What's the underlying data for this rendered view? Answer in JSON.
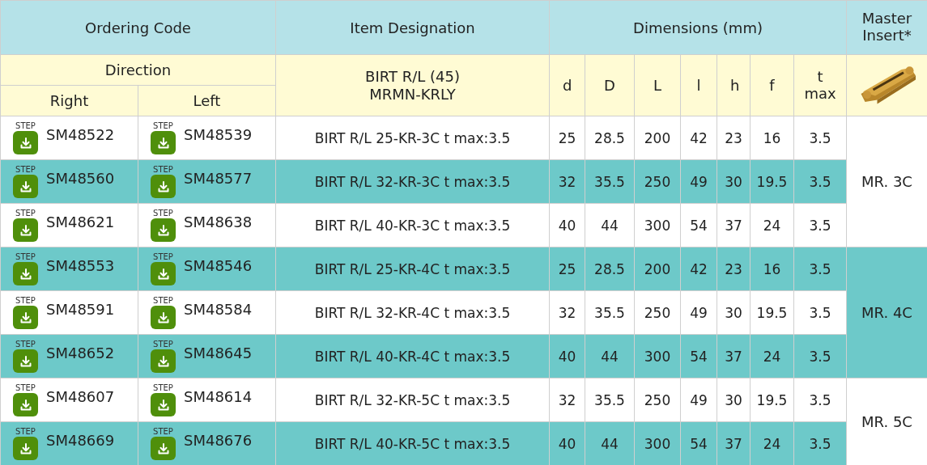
{
  "header": {
    "ordering_code": "Ordering Code",
    "item_designation": "Item Designation",
    "dimensions": "Dimensions (mm)",
    "master_insert": "Master Insert*",
    "direction": "Direction",
    "right": "Right",
    "left": "Left",
    "designation_family": "BIRT R/L (45)",
    "designation_insert": "MRMN-KRLY",
    "dimension_columns": [
      "d",
      "D",
      "L",
      "l",
      "h",
      "f",
      "t max"
    ]
  },
  "groups": [
    {
      "master": "MR. 3C",
      "rows": [
        {
          "right": {
            "badge": "STEP",
            "code": "SM48522"
          },
          "left": {
            "badge": "STEP",
            "code": "SM48539"
          },
          "designation": "BIRT R/L 25-KR-3C t max:3.5",
          "dims": [
            "25",
            "28.5",
            "200",
            "42",
            "23",
            "16",
            "3.5"
          ]
        },
        {
          "right": {
            "badge": "STEP",
            "code": "SM48560"
          },
          "left": {
            "badge": "STEP",
            "code": "SM48577"
          },
          "designation": "BIRT R/L 32-KR-3C t max:3.5",
          "dims": [
            "32",
            "35.5",
            "250",
            "49",
            "30",
            "19.5",
            "3.5"
          ]
        },
        {
          "right": {
            "badge": "STEP",
            "code": "SM48621"
          },
          "left": {
            "badge": "STEP",
            "code": "SM48638"
          },
          "designation": "BIRT R/L 40-KR-3C t max:3.5",
          "dims": [
            "40",
            "44",
            "300",
            "54",
            "37",
            "24",
            "3.5"
          ]
        }
      ]
    },
    {
      "master": "MR. 4C",
      "rows": [
        {
          "right": {
            "badge": "STEP",
            "code": "SM48553"
          },
          "left": {
            "badge": "STEP",
            "code": "SM48546"
          },
          "designation": "BIRT R/L 25-KR-4C t max:3.5",
          "dims": [
            "25",
            "28.5",
            "200",
            "42",
            "23",
            "16",
            "3.5"
          ]
        },
        {
          "right": {
            "badge": "STEP",
            "code": "SM48591"
          },
          "left": {
            "badge": "STEP",
            "code": "SM48584"
          },
          "designation": "BIRT R/L 32-KR-4C t max:3.5",
          "dims": [
            "32",
            "35.5",
            "250",
            "49",
            "30",
            "19.5",
            "3.5"
          ]
        },
        {
          "right": {
            "badge": "STEP",
            "code": "SM48652"
          },
          "left": {
            "badge": "STEP",
            "code": "SM48645"
          },
          "designation": "BIRT R/L 40-KR-4C t max:3.5",
          "dims": [
            "40",
            "44",
            "300",
            "54",
            "37",
            "24",
            "3.5"
          ]
        }
      ]
    },
    {
      "master": "MR. 5C",
      "rows": [
        {
          "right": {
            "badge": "STEP",
            "code": "SM48607"
          },
          "left": {
            "badge": "STEP",
            "code": "SM48614"
          },
          "designation": "BIRT R/L 32-KR-5C t max:3.5",
          "dims": [
            "32",
            "35.5",
            "250",
            "49",
            "30",
            "19.5",
            "3.5"
          ]
        },
        {
          "right": {
            "badge": "STEP",
            "code": "SM48669"
          },
          "left": {
            "badge": "STEP",
            "code": "SM48676"
          },
          "designation": "BIRT R/L 40-KR-5C t max:3.5",
          "dims": [
            "40",
            "44",
            "300",
            "54",
            "37",
            "24",
            "3.5"
          ]
        }
      ]
    }
  ]
}
